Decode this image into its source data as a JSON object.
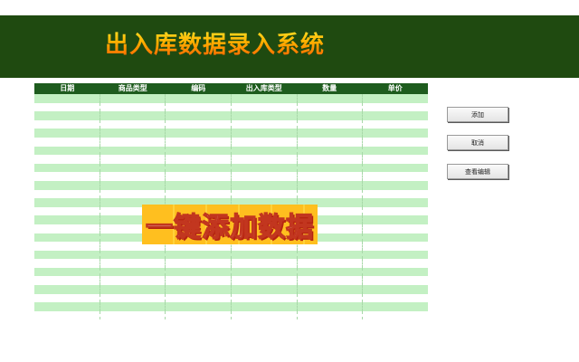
{
  "header": {
    "title": "出入库数据录入系统",
    "background_color": "#1f4a10"
  },
  "grid": {
    "columns": [
      "日期",
      "商品类型",
      "编码",
      "出入库类型",
      "数量",
      "单价"
    ],
    "header_color": "#1e5c1e",
    "band_color": "#c3f0c3",
    "row_count": 26
  },
  "buttons": {
    "add_label": "添加",
    "cancel_label": "取消",
    "view_edit_label": "查看编辑"
  },
  "overlay": {
    "caption": "一键添加数据"
  }
}
